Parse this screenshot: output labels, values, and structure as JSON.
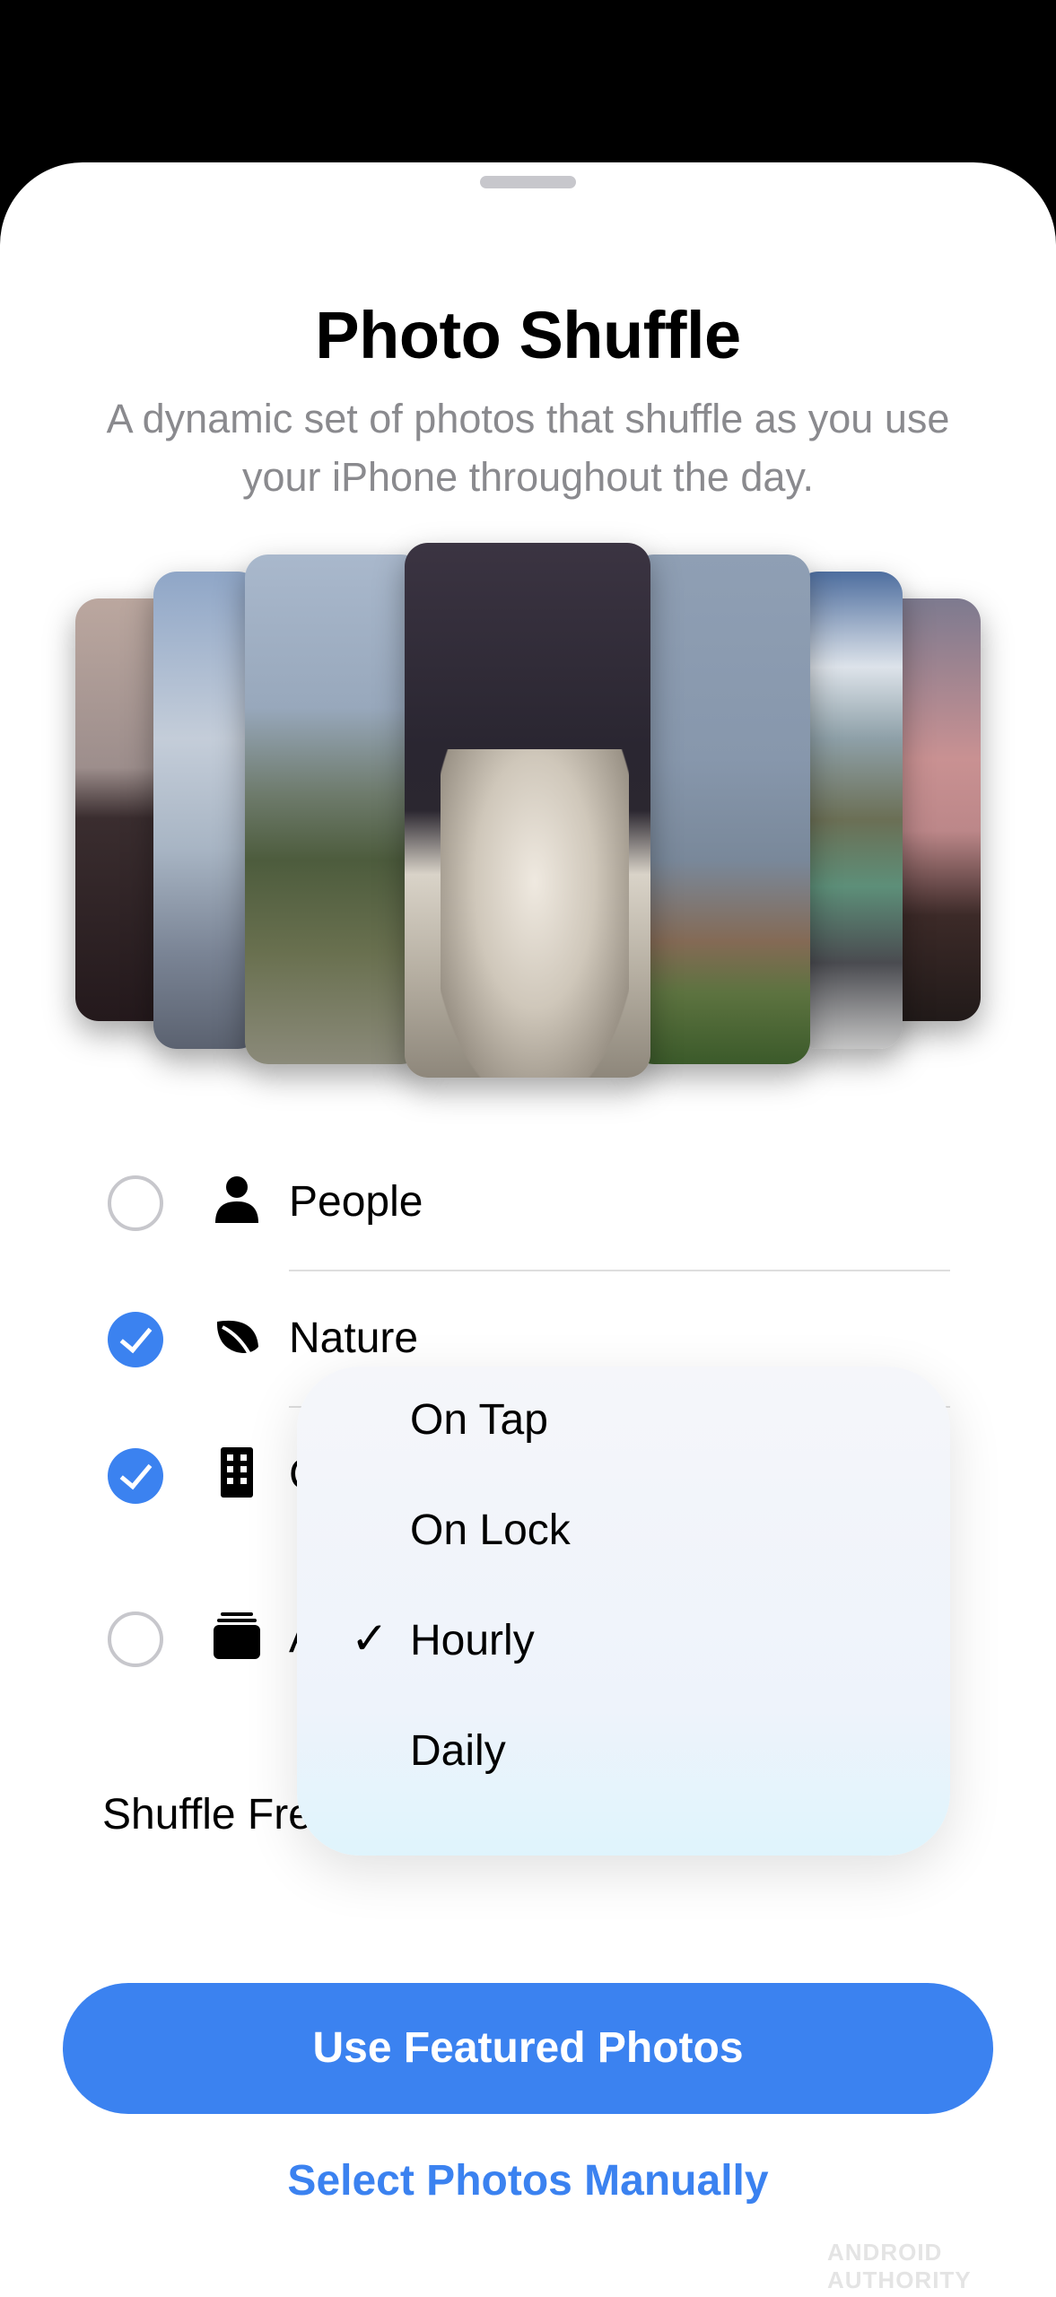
{
  "header": {
    "title": "Photo Shuffle",
    "subtitle": "A dynamic set of photos that shuffle as you use your iPhone throughout the day."
  },
  "categories": [
    {
      "label": "People",
      "checked": false,
      "icon": "person-icon"
    },
    {
      "label": "Nature",
      "checked": true,
      "icon": "leaf-icon"
    },
    {
      "label": "C",
      "checked": true,
      "icon": "building-icon"
    },
    {
      "label": "A",
      "checked": false,
      "icon": "stack-icon"
    }
  ],
  "shuffle_frequency": {
    "label": "Shuffle Fre",
    "options": [
      "On Tap",
      "On Lock",
      "Hourly",
      "Daily"
    ],
    "selected": "Hourly",
    "check_mark": "✓"
  },
  "buttons": {
    "primary": "Use Featured Photos",
    "secondary": "Select Photos Manually"
  },
  "colors": {
    "accent": "#3b82f0",
    "secondary_text": "#8a8a8e"
  },
  "watermark": "ANDROID AUTHORITY"
}
